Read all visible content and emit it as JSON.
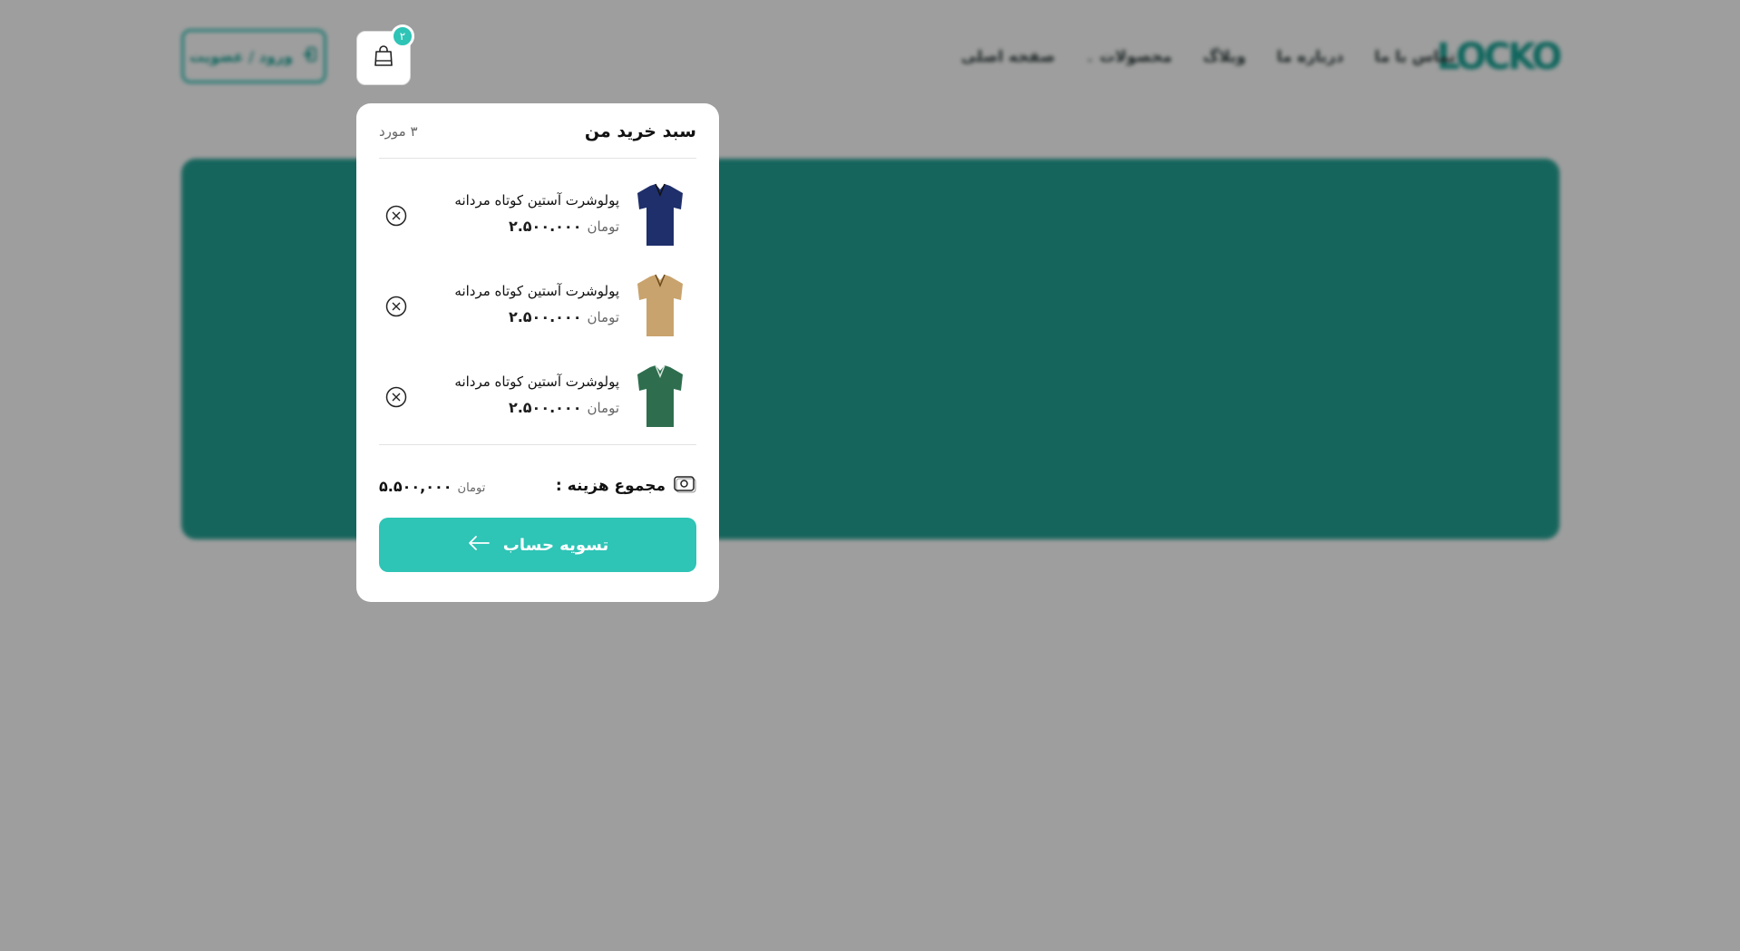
{
  "brand": {
    "logo_text": "LOCKO",
    "accent_color": "#2ec4b6"
  },
  "nav": {
    "items": [
      {
        "label": "صفحه اصلی"
      },
      {
        "label": "محصولات"
      },
      {
        "label": "وبلاگ"
      },
      {
        "label": "درباره ما"
      },
      {
        "label": "تماس با ما"
      }
    ]
  },
  "header": {
    "login_label": "ورود / عضویت"
  },
  "cart": {
    "badge_count": "۲",
    "title": "سبد خرید من",
    "count_label": "۳ مورد",
    "items": [
      {
        "name": "پولوشرت آستین کوتاه مردانه",
        "price": "۲.۵۰۰.۰۰۰",
        "currency": "تومان",
        "color": "#1f2f6b"
      },
      {
        "name": "پولوشرت آستین کوتاه مردانه",
        "price": "۲.۵۰۰.۰۰۰",
        "currency": "تومان",
        "color": "#c9a36d"
      },
      {
        "name": "پولوشرت آستین کوتاه مردانه",
        "price": "۲.۵۰۰.۰۰۰",
        "currency": "تومان",
        "color": "#2e6e4e"
      }
    ],
    "total_label": "مجموع هزینه :",
    "total_value": "۵.۵۰۰,۰۰۰",
    "total_currency": "تومان",
    "checkout_label": "تسویه حساب"
  }
}
